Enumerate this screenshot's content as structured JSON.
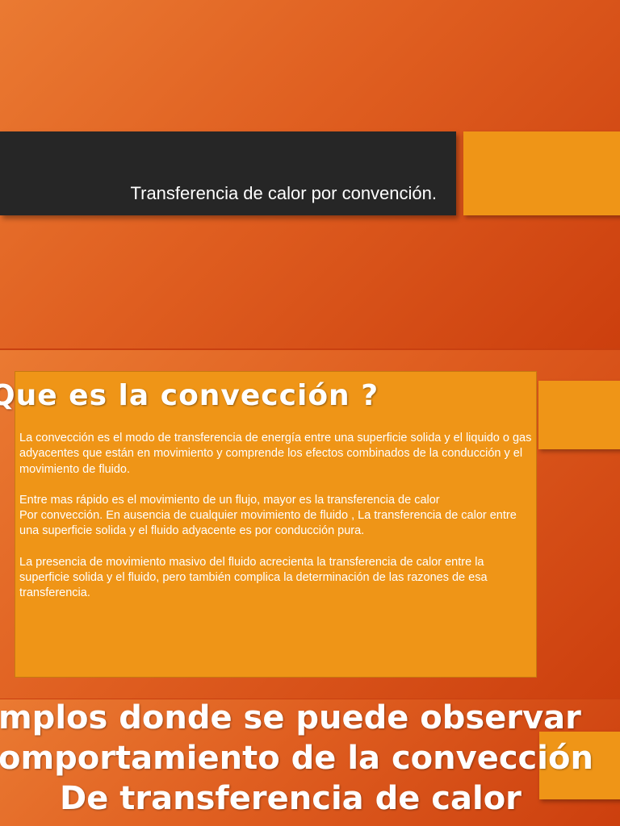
{
  "slide1": {
    "title": "Transferencia de calor por convención."
  },
  "slide2": {
    "heading": "Que es la convección ?",
    "paragraphs": [
      "La convección es el modo de transferencia de energía entre una superficie solida y el liquido o gas adyacentes que están en movimiento y comprende los efectos combinados de la conducción y el movimiento de fluido.",
      "Entre mas rápido es el movimiento de un flujo, mayor es la transferencia de calor\nPor convección. En ausencia de cualquier movimiento de fluido , La transferencia de calor entre  una superficie solida y el fluido adyacente es por conducción pura.",
      "La presencia de movimiento masivo del fluido  acrecienta la transferencia de calor entre la superficie solida y el fluido, pero también complica la determinación de las razones de esa transferencia."
    ]
  },
  "slide3": {
    "lines": [
      "mplos donde se puede observar",
      "omportamiento de la convección",
      "De transferencia de calor"
    ]
  }
}
